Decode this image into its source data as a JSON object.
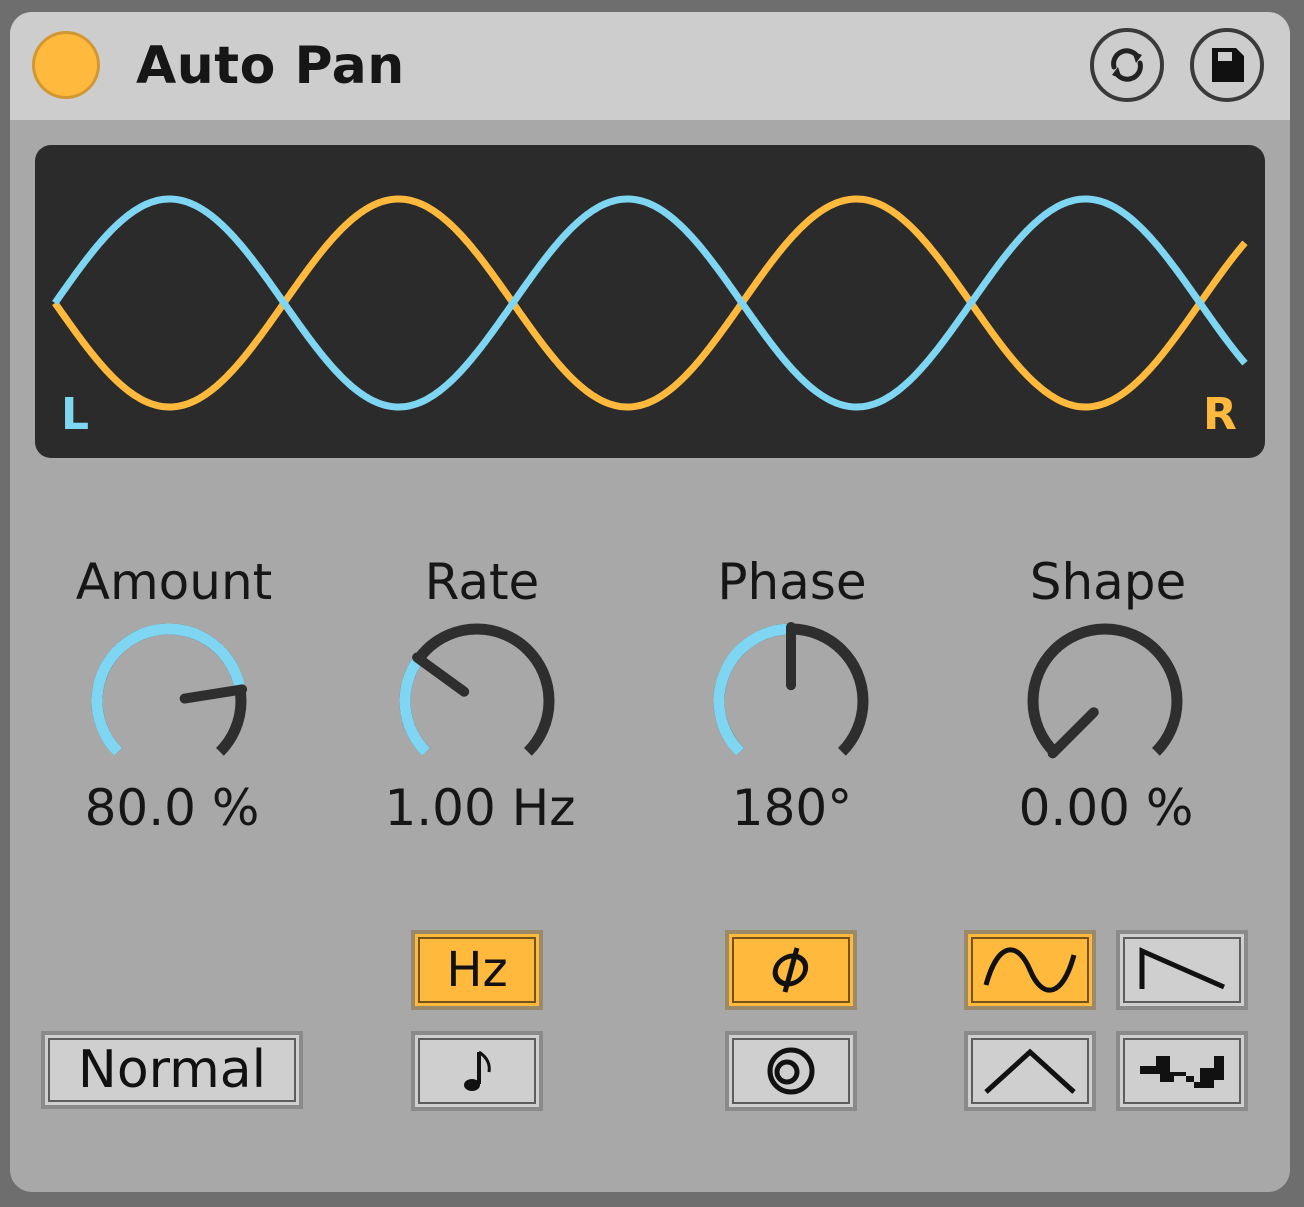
{
  "device": {
    "title": "Auto Pan",
    "accent_color": "#ffb93d",
    "header_buttons": [
      "refresh-icon",
      "save-icon"
    ]
  },
  "display": {
    "left_label": "L",
    "right_label": "R",
    "left_color": "#7fd6f2",
    "right_color": "#ffb93d"
  },
  "knobs": [
    {
      "label": "Amount",
      "value": "80.0 %",
      "level": 0.8
    },
    {
      "label": "Rate",
      "value": "1.00 Hz",
      "level": 0.3
    },
    {
      "label": "Phase",
      "value": "180°",
      "level": 0.5
    },
    {
      "label": "Shape",
      "value": "0.00 %",
      "level": 0.0
    }
  ],
  "buttons": {
    "mode": "Normal",
    "rate_hz": {
      "label": "Hz",
      "active": true
    },
    "rate_sync": {
      "icon": "note-icon",
      "active": false
    },
    "phase": {
      "icon": "phase-icon",
      "active": true
    },
    "spin": {
      "icon": "spin-icon",
      "active": false
    },
    "shapes": [
      {
        "icon": "sine-wave-icon",
        "active": true
      },
      {
        "icon": "saw-down-icon",
        "active": false
      },
      {
        "icon": "triangle-wave-icon",
        "active": false
      },
      {
        "icon": "random-wave-icon",
        "active": false
      }
    ]
  }
}
